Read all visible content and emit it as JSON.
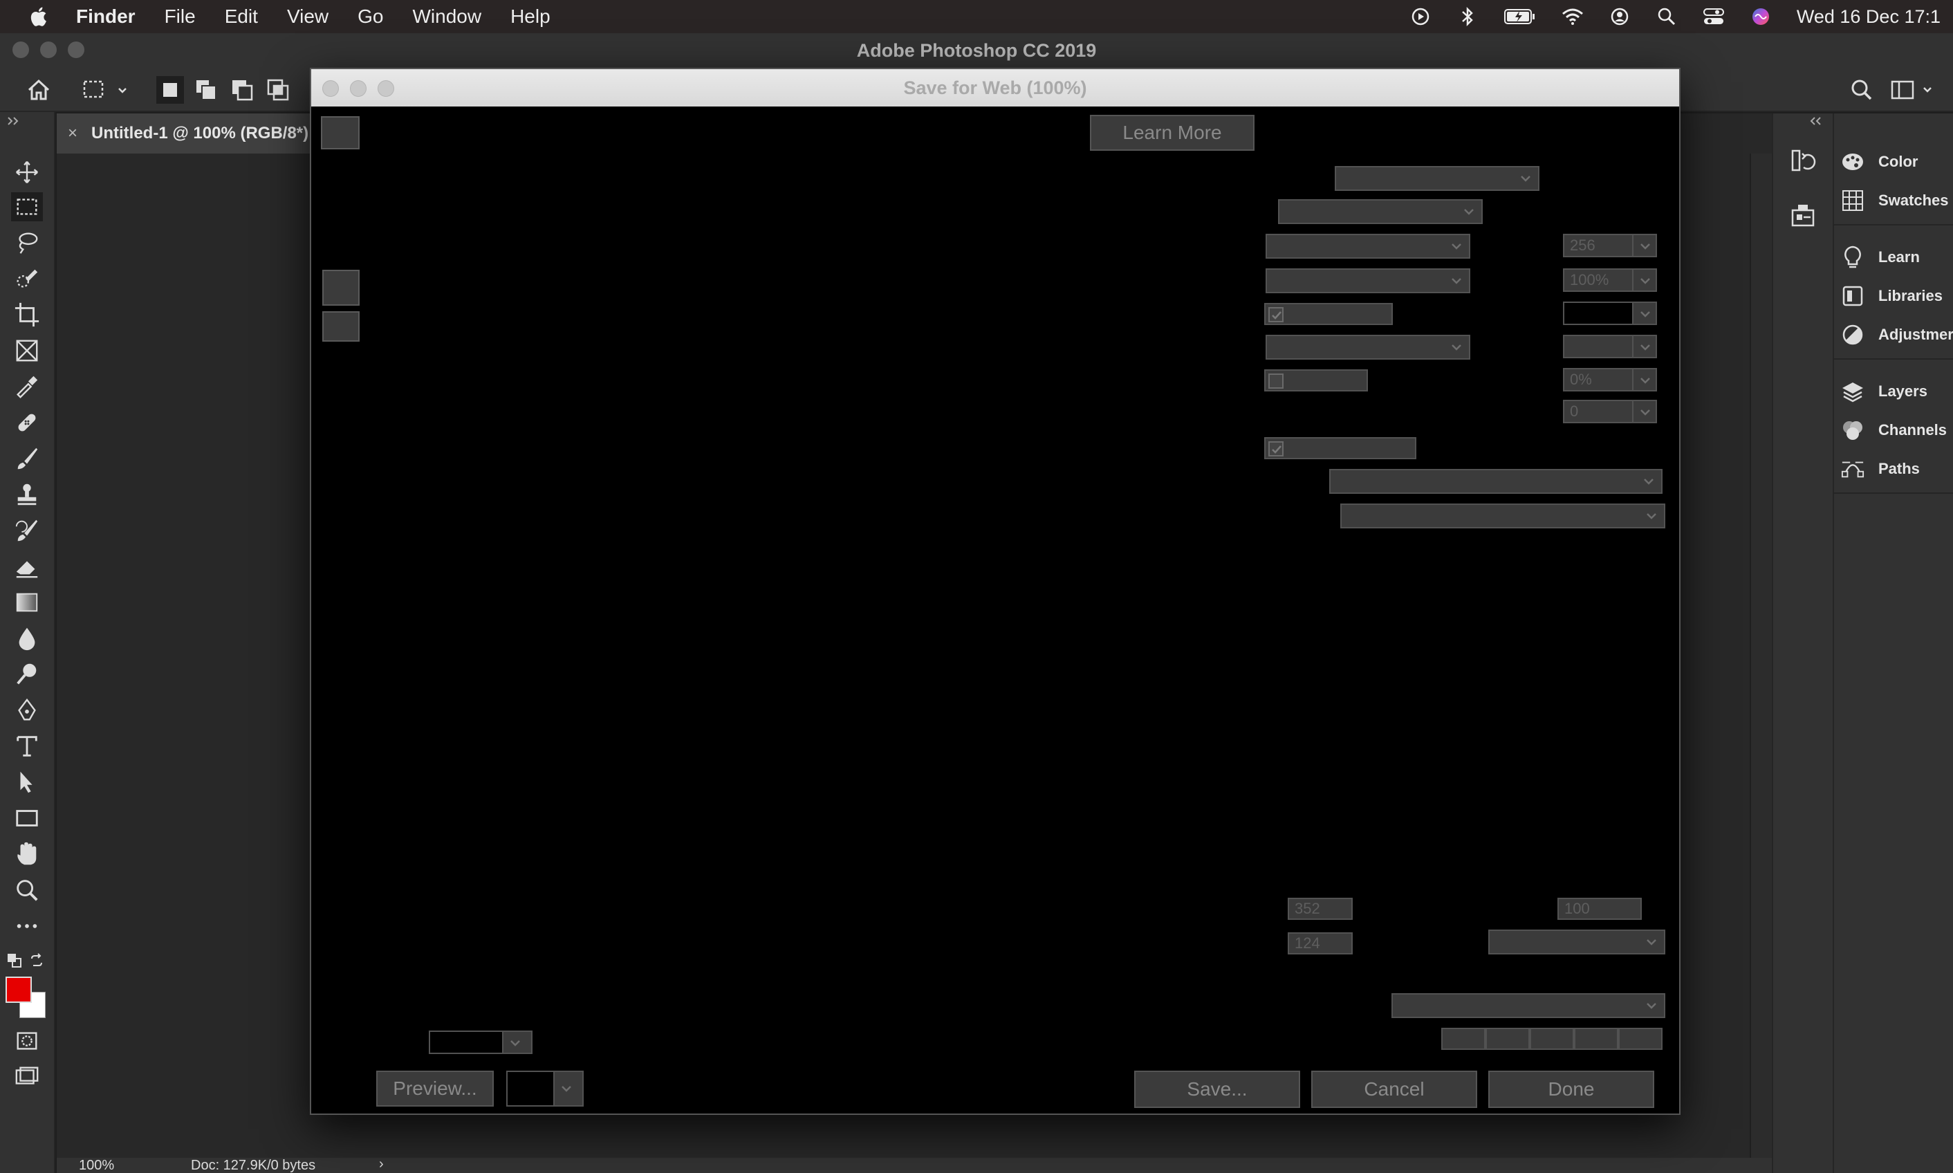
{
  "menubar": {
    "app": "Finder",
    "items": [
      "File",
      "Edit",
      "View",
      "Go",
      "Window",
      "Help"
    ],
    "clock": "Wed 16 Dec  17:1"
  },
  "ps_window": {
    "title": "Adobe Photoshop CC 2019"
  },
  "document": {
    "tab_label": "Untitled-1 @ 100% (RGB/8*)",
    "close_glyph": "×"
  },
  "status": {
    "zoom": "100%",
    "doc_info": "Doc: 127.9K/0 bytes",
    "arrow": "›"
  },
  "panels": {
    "group1": [
      "Color",
      "Swatches"
    ],
    "group2": [
      "Learn",
      "Libraries",
      "Adjustmer"
    ],
    "group3": [
      "Layers",
      "Channels",
      "Paths"
    ]
  },
  "dialog": {
    "title": "Save for Web (100%)",
    "learn_more": "Learn More",
    "colors_value": "256",
    "dither_value": "100%",
    "lossy_value": "0%",
    "web_snap_value": "0",
    "width_value": "352",
    "height_value": "124",
    "percent_value": "100",
    "preview_label": "Preview...",
    "save_label": "Save...",
    "cancel_label": "Cancel",
    "done_label": "Done"
  },
  "colors": {
    "foreground": "#e60000",
    "background": "#ffffff"
  }
}
